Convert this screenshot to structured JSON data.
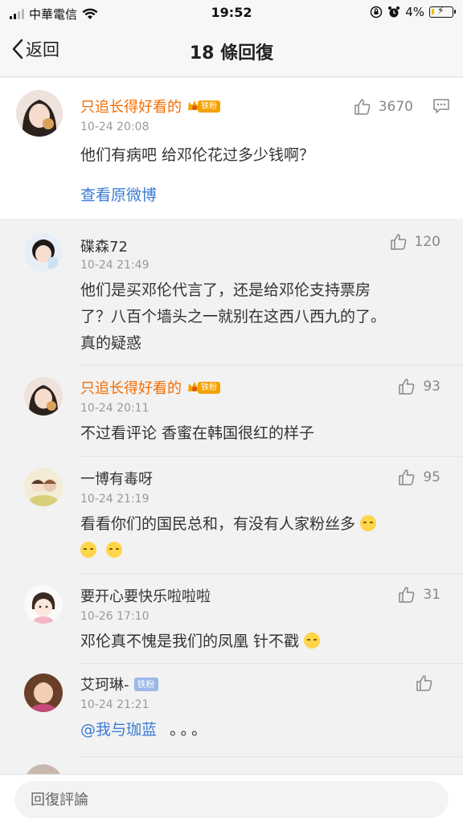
{
  "status_bar": {
    "carrier": "中華電信",
    "time": "19:52",
    "battery": "4%"
  },
  "nav": {
    "back_label": "返回",
    "title": "18 條回復"
  },
  "main_comment": {
    "username": "只追长得好看的",
    "badge": "铁粉",
    "time": "10-24 20:08",
    "content": "他们有病吧 给邓伦花过多少钱啊？",
    "likes": "3670",
    "view_original": "查看原微博"
  },
  "replies": [
    {
      "username": "碟森72",
      "time": "10-24 21:49",
      "lines": [
        "他们是买邓伦代言了，还是给邓伦支持票房",
        "了？八百个墙头之一就别在这西八西九的了。",
        "真的疑惑"
      ],
      "likes": "120"
    },
    {
      "username": "只追长得好看的",
      "badge": "铁粉",
      "time": "10-24 20:11",
      "lines": [
        "不过看评论 香蜜在韩国很红的样子"
      ],
      "likes": "93"
    },
    {
      "username": "一博有毒呀",
      "time": "10-24 21:19",
      "lines": [
        "看看你们的国民总和，有没有人家粉丝多"
      ],
      "likes": "95"
    },
    {
      "username": "要开心要快乐啦啦啦",
      "time": "10-26 17:10",
      "lines": [
        "邓伦真不愧是我们的凤凰 针不戳"
      ],
      "likes": "31"
    },
    {
      "username": "艾珂琳-",
      "badge": "铁粉",
      "time": "10-24 21:21",
      "mention": "@我与珈蓝",
      "after_mention": "。。。",
      "likes": ""
    }
  ],
  "bottom": {
    "placeholder": "回復評論"
  }
}
